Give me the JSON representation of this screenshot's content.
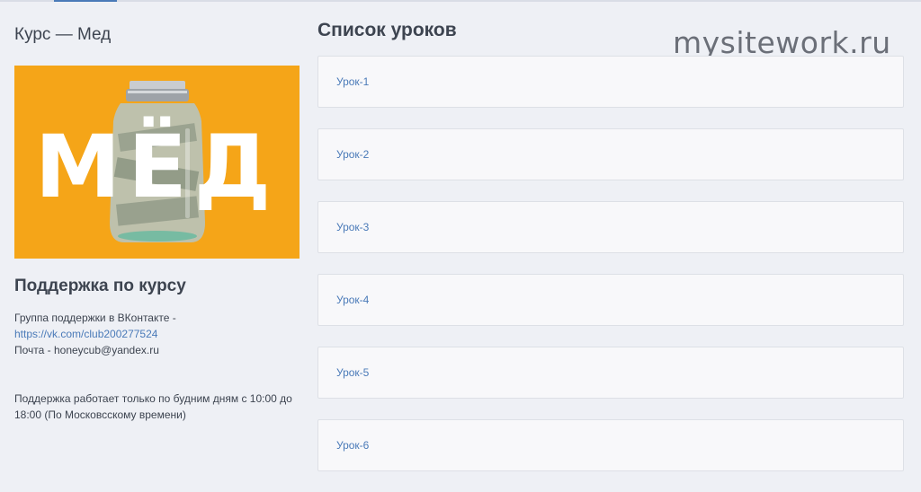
{
  "course": {
    "title": "Курс — Мед"
  },
  "cover": {
    "word": "МЁД",
    "bg_color": "#f5a518"
  },
  "support": {
    "title": "Поддержка по курсу",
    "group_text": "Группа поддержки в ВКонтакте -",
    "group_link": "https://vk.com/club200277524",
    "mail_text": "Почта - honeycub@yandex.ru",
    "hours_text": "Поддержка работает только по будним дням с 10:00 до 18:00 (По Московсскому времени)"
  },
  "lessons": {
    "title": "Список уроков",
    "items": [
      {
        "label": "Урок-1"
      },
      {
        "label": "Урок-2"
      },
      {
        "label": "Урок-3"
      },
      {
        "label": "Урок-4"
      },
      {
        "label": "Урок-5"
      },
      {
        "label": "Урок-6"
      }
    ]
  },
  "watermark": "mysitework.ru",
  "colors": {
    "accent": "#4a7ab8",
    "background": "#eef0f5"
  }
}
